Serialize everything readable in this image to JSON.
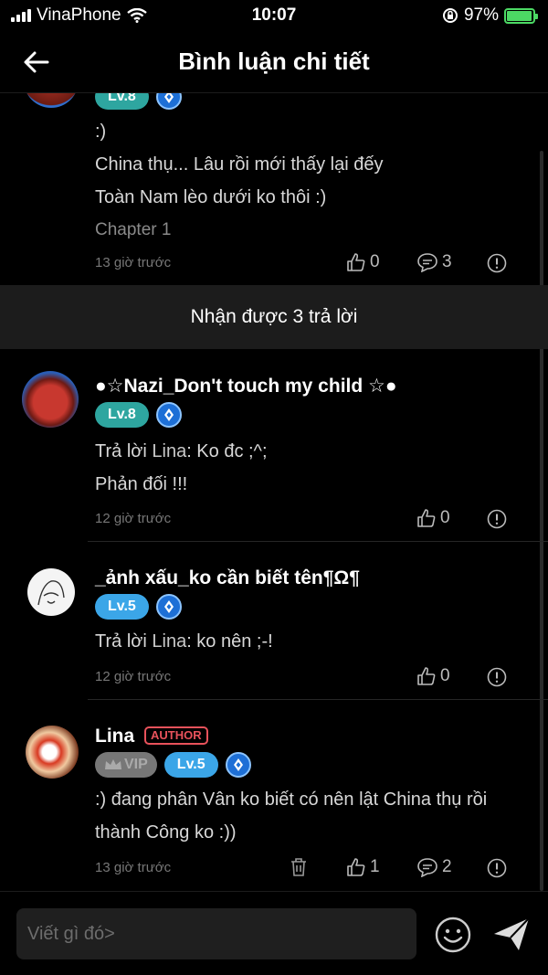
{
  "status_bar": {
    "carrier": "VinaPhone",
    "time": "10:07",
    "battery": "97%"
  },
  "header": {
    "title": "Bình luận chi tiết"
  },
  "parent_comment": {
    "level": "Lv.8",
    "lines": [
      ":)",
      "China thụ... Lâu rồi mới thấy lại đếy",
      "Toàn Nam lèo dưới ko thôi :)"
    ],
    "chapter": "Chapter 1",
    "time": "13 giờ trước",
    "likes": "0",
    "replies": "3"
  },
  "replies_bar": {
    "label": "Nhận được 3 trả lời"
  },
  "replies": [
    {
      "username": "●☆Nazi_Don't touch my child ☆●",
      "level": "Lv.8",
      "reply_prefix": "Trả lời ",
      "reply_to": "Lina",
      "reply_text": ": Ko đc ;^;",
      "line2": "Phản đối !!!",
      "time": "12 giờ trước",
      "likes": "0"
    },
    {
      "username": "_ảnh xấu_ko cần biết tên¶Ω¶",
      "level": "Lv.5",
      "reply_prefix": "Trả lời ",
      "reply_to": "Lina",
      "reply_text": ": ko nên ;-!",
      "time": "12 giờ trước",
      "likes": "0"
    },
    {
      "username": "Lina",
      "author_tag": "AUTHOR",
      "vip": "VIP",
      "level": "Lv.5",
      "line1": ":) đang phân Vân ko biết có nên lật China thụ rồi",
      "line2": "thành Công ko :))",
      "time": "13 giờ trước",
      "likes": "1",
      "replies": "2"
    }
  ],
  "composer": {
    "placeholder": "Viết gì đó>"
  },
  "colors": {
    "teal_badge": "#2ea6a0",
    "blue_badge": "#3ba6e8",
    "author": "#e8525b",
    "battery": "#4cd964"
  }
}
